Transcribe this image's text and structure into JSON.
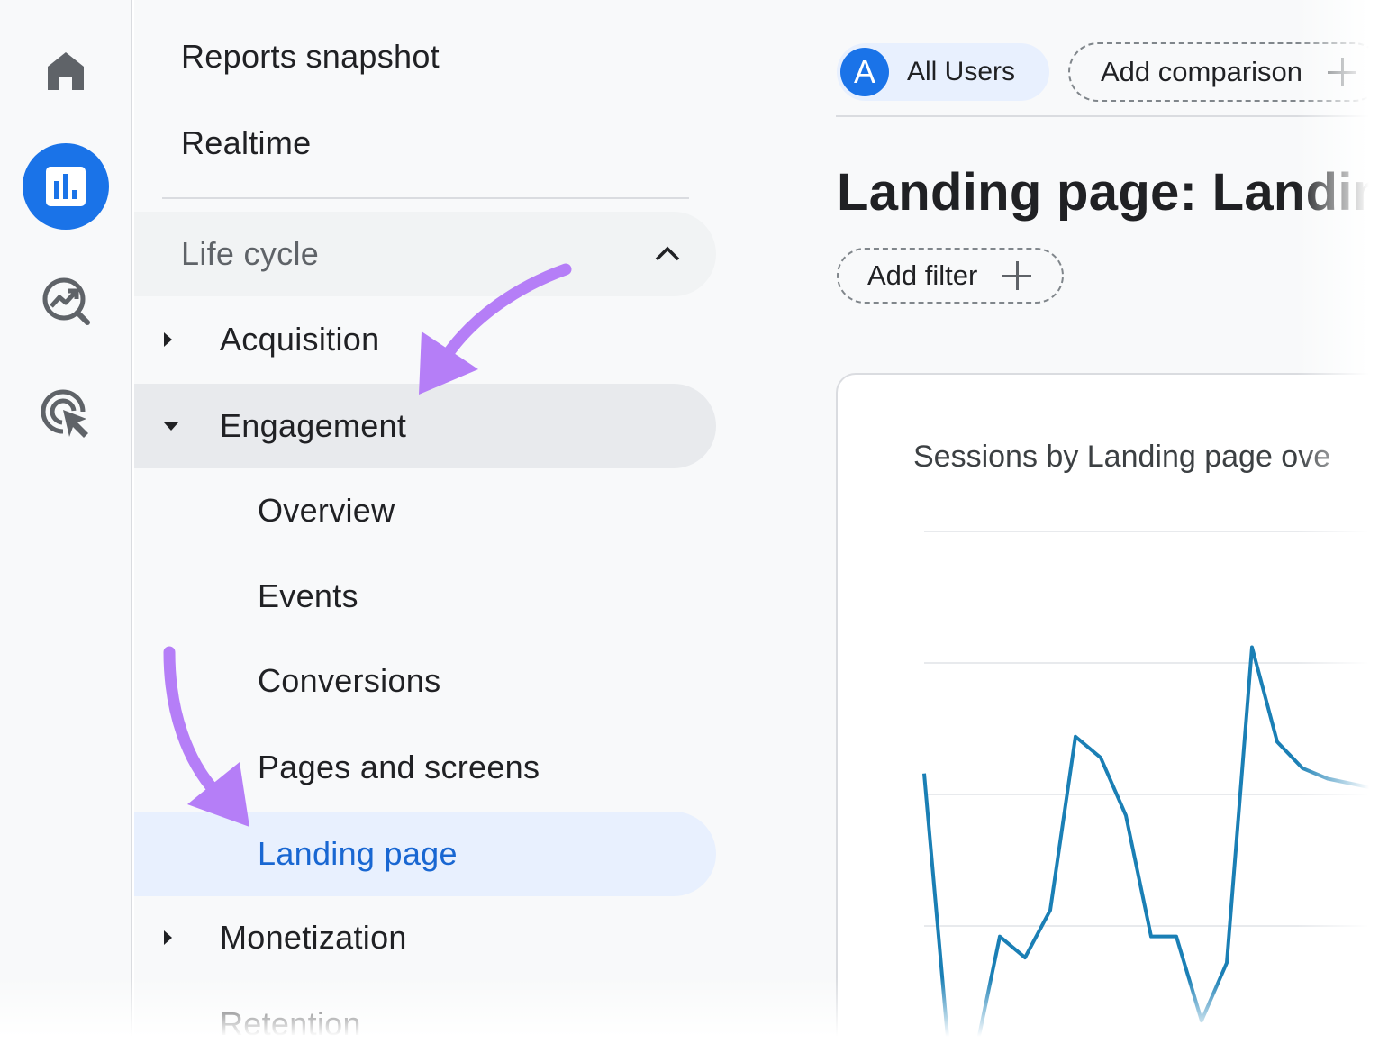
{
  "rail": {
    "items": [
      {
        "icon": "home-icon",
        "active": false
      },
      {
        "icon": "reports-bar-chart-icon",
        "active": true
      },
      {
        "icon": "explore-insights-icon",
        "active": false
      },
      {
        "icon": "advertising-cursor-icon",
        "active": false
      }
    ]
  },
  "sidebar": {
    "reports_snapshot": "Reports snapshot",
    "realtime": "Realtime",
    "lifecycle": "Life cycle",
    "acquisition": "Acquisition",
    "engagement": "Engagement",
    "overview": "Overview",
    "events": "Events",
    "conversions": "Conversions",
    "pages_and_screens": "Pages and screens",
    "landing_page": "Landing page",
    "monetization": "Monetization",
    "retention": "Retention"
  },
  "toolbar": {
    "avatar_letter": "A",
    "all_users": "All Users",
    "add_comparison": "Add comparison"
  },
  "main": {
    "title": "Landing page: Landing",
    "add_filter": "Add filter",
    "card_title": "Sessions by Landing page ove"
  },
  "colors": {
    "accent": "#1a73e8",
    "selected_bg": "#e8f0fe",
    "selected_text": "#1967d2",
    "series": "#1a7fb5",
    "annotation_arrow": "#b57ef7"
  },
  "chart_data": {
    "type": "line",
    "title": "Sessions by Landing page ove",
    "xlabel": "",
    "ylabel": "",
    "grid": true,
    "legend": "none",
    "ylim": [
      0,
      100
    ],
    "x": [
      1,
      2,
      3,
      4,
      5,
      6,
      7,
      8,
      9,
      10,
      11,
      12,
      13,
      14,
      15,
      16,
      17,
      18,
      19
    ],
    "series": [
      {
        "values": [
          54,
          0,
          0,
          23,
          19,
          28,
          61,
          57,
          46,
          23,
          23,
          7,
          18,
          78,
          60,
          55,
          53,
          52,
          51
        ]
      }
    ]
  }
}
